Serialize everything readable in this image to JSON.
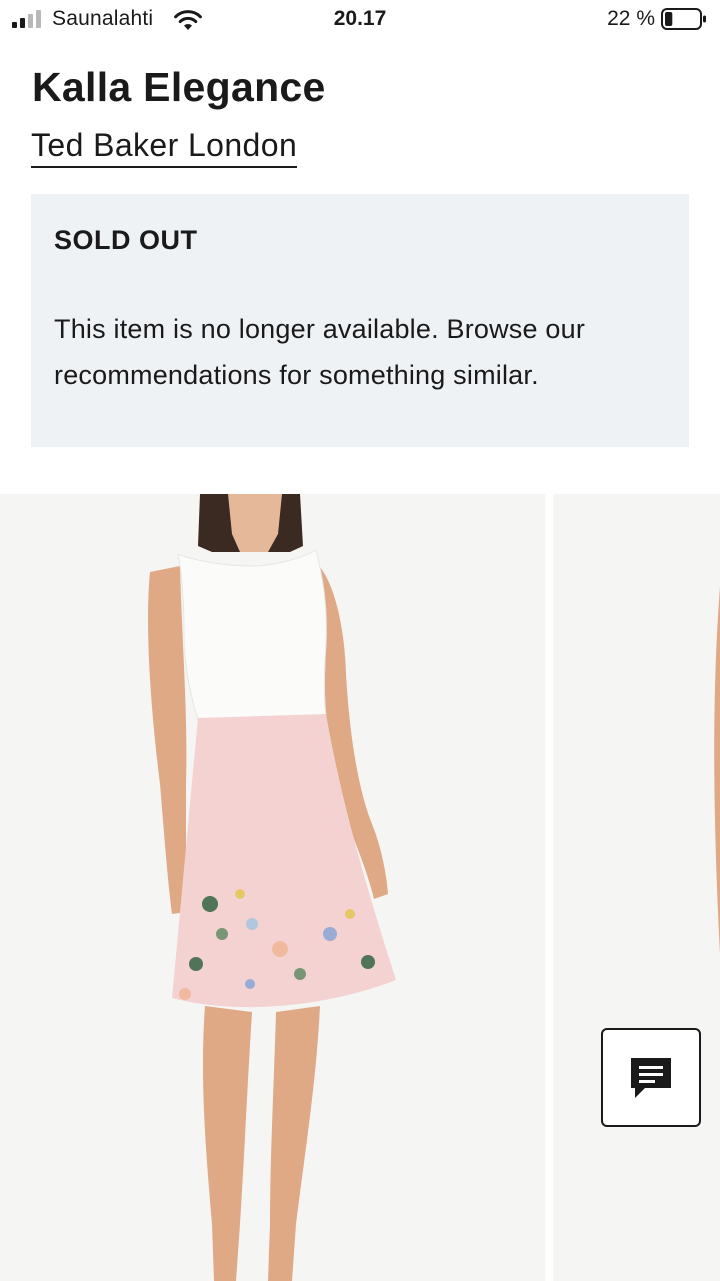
{
  "status_bar": {
    "carrier": "Saunalahti",
    "time": "20.17",
    "battery_percent": "22 %",
    "battery_level": 0.22,
    "signal_bars_active": 2,
    "signal_bars_total": 4,
    "icons": [
      "signal-icon",
      "wifi-icon",
      "battery-icon"
    ]
  },
  "product": {
    "title": "Kalla Elegance",
    "brand": "Ted Baker London"
  },
  "notice": {
    "title": "SOLD OUT",
    "message": "This item is no longer available. Browse our recommendations for something similar."
  },
  "colors": {
    "notice_bg": "#eff2f5",
    "text": "#1a1a1a",
    "image_bg": "#f5f5f4",
    "dress_top": "#fbfbfa",
    "dress_skirt": "#f4d2d2"
  },
  "chat": {
    "icon": "chat-icon"
  }
}
